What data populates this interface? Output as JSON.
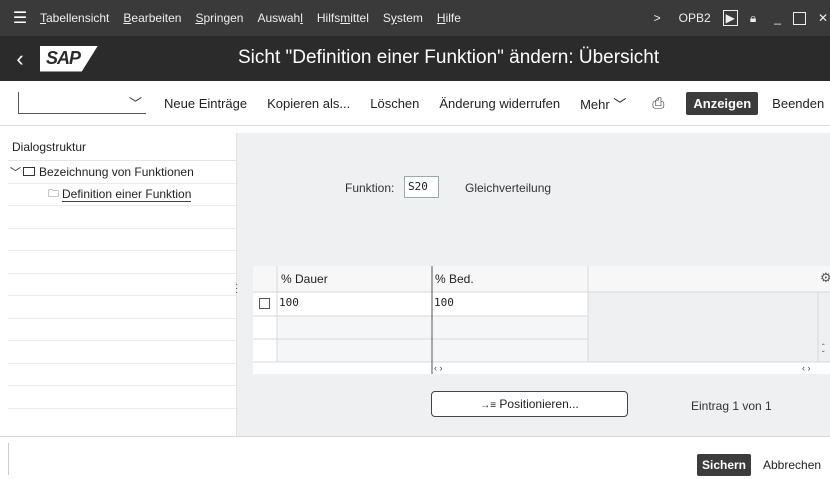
{
  "menubar": {
    "items": [
      {
        "pre": "",
        "u": "T",
        "post": "abellensicht"
      },
      {
        "pre": "",
        "u": "B",
        "post": "earbeiten"
      },
      {
        "pre": "",
        "u": "S",
        "post": "pringen"
      },
      {
        "pre": "Auswah",
        "u": "l",
        "post": ""
      },
      {
        "pre": "Hilfs",
        "u": "m",
        "post": "ittel"
      },
      {
        "pre": "S",
        "u": "y",
        "post": "stem"
      },
      {
        "pre": "",
        "u": "H",
        "post": "ilfe"
      }
    ],
    "more": ">",
    "transaction": "OPB2"
  },
  "titlebar": {
    "logo": "SAP",
    "title": "Sicht \"Definition einer Funktion\" ändern: Übersicht"
  },
  "toolbar": {
    "new_entries": "Neue Einträge",
    "copy_as": "Kopieren als...",
    "delete": "Löschen",
    "undo_change": "Änderung widerrufen",
    "more": "Mehr",
    "display": "Anzeigen",
    "exit": "Beenden"
  },
  "dialog": {
    "header": "Dialogstruktur",
    "node_parent": "Bezeichnung von Funktionen",
    "node_child": "Definition einer Funktion"
  },
  "main": {
    "field_label": "Funktion:",
    "field_value": "S20",
    "field_desc": "Gleichverteilung",
    "columns": [
      "% Dauer",
      "% Bed."
    ],
    "rows": [
      {
        "dauer": "100",
        "bed": "100"
      }
    ],
    "position_button": "Positionieren...",
    "entry_info": "Eintrag 1 von 1"
  },
  "footer": {
    "save": "Sichern",
    "cancel": "Abbrechen"
  }
}
